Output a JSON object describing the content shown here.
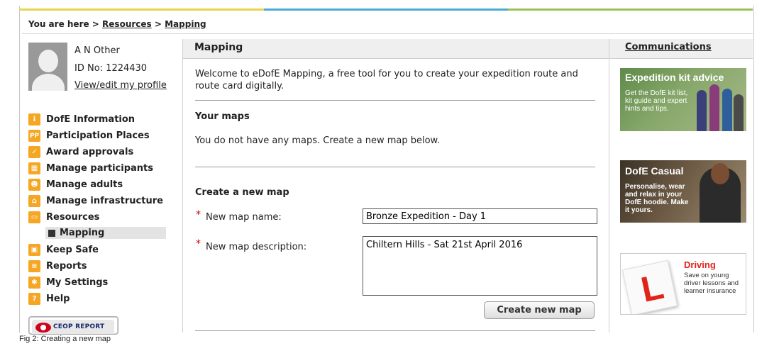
{
  "colors": {
    "stripe": [
      "#e8d44d",
      "#4aaad6",
      "#9bc05a"
    ],
    "nav_icon": "#f5a623",
    "accent_red": "#cc0000"
  },
  "breadcrumb": {
    "prefix": "You are here >",
    "link1": "Resources",
    "sep": ">",
    "link2": "Mapping"
  },
  "profile": {
    "name": "A N Other",
    "id": "ID No: 1224430",
    "edit_link": "View/edit my profile"
  },
  "nav": {
    "items": [
      {
        "label": "DofE Information",
        "icon": "book-icon",
        "glyph": "i"
      },
      {
        "label": "Participation Places",
        "icon": "pp-icon",
        "glyph": "PP"
      },
      {
        "label": "Award approvals",
        "icon": "checkmark-icon",
        "glyph": "✓"
      },
      {
        "label": "Manage participants",
        "icon": "grid-icon",
        "glyph": "▦"
      },
      {
        "label": "Manage adults",
        "icon": "people-icon",
        "glyph": "☻"
      },
      {
        "label": "Manage infrastructure",
        "icon": "home-icon",
        "glyph": "⌂"
      },
      {
        "label": "Resources",
        "icon": "folder-icon",
        "glyph": "▭"
      }
    ],
    "sub_item": "Mapping",
    "items_after": [
      {
        "label": "Keep Safe",
        "icon": "lock-icon",
        "glyph": "▣"
      },
      {
        "label": "Reports",
        "icon": "document-icon",
        "glyph": "≡"
      },
      {
        "label": "My Settings",
        "icon": "settings-icon",
        "glyph": "✱"
      },
      {
        "label": "Help",
        "icon": "help-icon",
        "glyph": "?"
      }
    ],
    "ceop": "CEOP REPORT"
  },
  "main": {
    "title": "Mapping",
    "welcome": "Welcome to eDofE Mapping, a free tool for you to create your expedition route and route card digitally.",
    "your_maps_heading": "Your maps",
    "no_maps_text": "You do not have any maps. Create a new map below.",
    "create_heading": "Create a new map",
    "required_mark": "*",
    "name_label": "New map name:",
    "name_value": "Bronze Expedition - Day 1",
    "desc_label": "New map description:",
    "desc_value": "Chiltern Hills - Sat 21st April 2016",
    "create_button": "Create new map"
  },
  "right": {
    "communications": "Communications",
    "ad1": {
      "title": "Expedition kit advice",
      "text": "Get the DofE kit list, kit guide and expert hints and tips."
    },
    "ad2": {
      "title": "DofE Casual",
      "text": "Personalise, wear and relax in your DofE hoodie. Make it yours."
    },
    "ad3": {
      "title": "Driving",
      "text": "Save on young driver lessons and learner insurance",
      "plate_letter": "L"
    }
  },
  "caption": "Fig 2: Creating a new map"
}
